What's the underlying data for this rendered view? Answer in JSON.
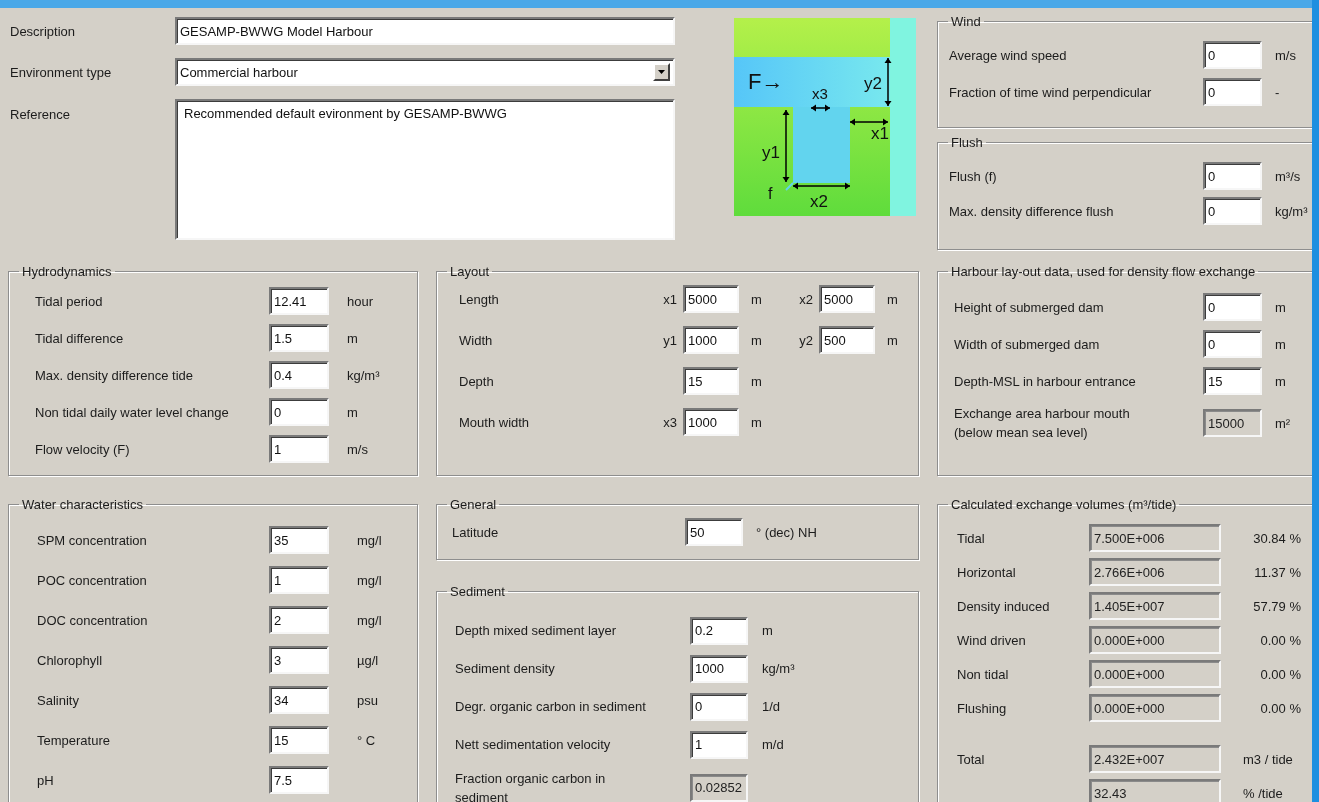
{
  "header": {
    "fields": [
      {
        "label": "Description",
        "value": "GESAMP-BWWG Model Harbour",
        "kind": "text"
      },
      {
        "label": "Environment type",
        "value": "Commercial harbour",
        "kind": "dropdown"
      },
      {
        "label": "Reference",
        "value": "Recommended default evironment by GESAMP-BWWG",
        "kind": "memo"
      }
    ]
  },
  "diagram": {
    "labels": [
      "F→",
      "x3",
      "y2",
      "y1",
      "x1",
      "f",
      "x2"
    ]
  },
  "wind": {
    "title": "Wind",
    "fields": [
      {
        "label": "Average wind speed",
        "value": "0",
        "unit": "m/s",
        "disabled": false
      },
      {
        "label": "Fraction of time wind perpendicular",
        "value": "0",
        "unit": "-",
        "disabled": false
      }
    ]
  },
  "flush": {
    "title": "Flush",
    "fields": [
      {
        "label": "Flush (f)",
        "value": "0",
        "unit": "m³/s",
        "disabled": false
      },
      {
        "label": "Max. density difference flush",
        "value": "0",
        "unit": "kg/m³",
        "disabled": false
      }
    ]
  },
  "hydrodynamics": {
    "title": "Hydrodynamics",
    "fields": [
      {
        "label": "Tidal period",
        "value": "12.41",
        "unit": "hour",
        "disabled": false
      },
      {
        "label": "Tidal difference",
        "value": "1.5",
        "unit": "m",
        "disabled": false
      },
      {
        "label": "Max. density difference tide",
        "value": "0.4",
        "unit": "kg/m³",
        "disabled": false
      },
      {
        "label": "Non tidal daily water level change",
        "value": "0",
        "unit": "m",
        "disabled": false
      },
      {
        "label": "Flow velocity (F)",
        "value": "1",
        "unit": "m/s",
        "disabled": false
      }
    ]
  },
  "layout": {
    "title": "Layout",
    "rows": [
      {
        "label": "Length",
        "fields": [
          {
            "symbol": "x1",
            "value": "5000",
            "unit": "m",
            "disabled": false
          },
          {
            "symbol": "x2",
            "value": "5000",
            "unit": "m",
            "disabled": false
          }
        ]
      },
      {
        "label": "Width",
        "fields": [
          {
            "symbol": "y1",
            "value": "1000",
            "unit": "m",
            "disabled": false
          },
          {
            "symbol": "y2",
            "value": "500",
            "unit": "m",
            "disabled": false
          }
        ]
      },
      {
        "label": "Depth",
        "fields": [
          {
            "value": "15",
            "unit": "m",
            "disabled": false
          }
        ]
      },
      {
        "label": "Mouth width",
        "fields": [
          {
            "symbol": "x3",
            "value": "1000",
            "unit": "m",
            "disabled": false
          }
        ]
      }
    ]
  },
  "harbour_layout": {
    "title": "Harbour lay-out data, used for density flow exchange",
    "fields": [
      {
        "label": "Height of submerged dam",
        "value": "0",
        "unit": "m",
        "disabled": false
      },
      {
        "label": "Width of submerged dam",
        "value": "0",
        "unit": "m",
        "disabled": false
      },
      {
        "label": "Depth-MSL in harbour entrance",
        "value": "15",
        "unit": "m",
        "disabled": false
      },
      {
        "label": "Exchange area harbour mouth\n(below mean sea level)",
        "value": "15000",
        "unit": "m²",
        "disabled": true
      }
    ]
  },
  "water_characteristics": {
    "title": "Water characteristics",
    "fields": [
      {
        "label": "SPM concentration",
        "value": "35",
        "unit": "mg/l",
        "disabled": false
      },
      {
        "label": "POC concentration",
        "value": "1",
        "unit": "mg/l",
        "disabled": false
      },
      {
        "label": "DOC concentration",
        "value": "2",
        "unit": "mg/l",
        "disabled": false
      },
      {
        "label": "Chlorophyll",
        "value": "3",
        "unit": "µg/l",
        "disabled": false
      },
      {
        "label": "Salinity",
        "value": "34",
        "unit": "psu",
        "disabled": false
      },
      {
        "label": "Temperature",
        "value": "15",
        "unit": "° C",
        "disabled": false
      },
      {
        "label": "pH",
        "value": "7.5",
        "disabled": false
      }
    ]
  },
  "general": {
    "title": "General",
    "fields": [
      {
        "label": "Latitude",
        "value": "50",
        "unit": "° (dec) NH",
        "disabled": false
      }
    ]
  },
  "sediment": {
    "title": "Sediment",
    "fields": [
      {
        "label": "Depth mixed sediment layer",
        "value": "0.2",
        "unit": "m",
        "disabled": false
      },
      {
        "label": "Sediment density",
        "value": "1000",
        "unit": "kg/m³",
        "disabled": false
      },
      {
        "label": "Degr. organic carbon in sediment",
        "value": "0",
        "unit": "1/d",
        "disabled": false
      },
      {
        "label": "Nett sedimentation velocity",
        "value": "1",
        "unit": "m/d",
        "disabled": false
      },
      {
        "label": "Fraction organic carbon in\nsediment",
        "value": "0.02852",
        "disabled": true
      }
    ]
  },
  "exchange_volumes": {
    "title": "Calculated exchange volumes (m³/tide)",
    "rows": [
      {
        "label": "Tidal",
        "value": "7.500E+006",
        "percent": "30.84 %",
        "disabled": true
      },
      {
        "label": "Horizontal",
        "value": "2.766E+006",
        "percent": "11.37 %",
        "disabled": true
      },
      {
        "label": "Density induced",
        "value": "1.405E+007",
        "percent": "57.79 %",
        "disabled": true
      },
      {
        "label": "Wind driven",
        "value": "0.000E+000",
        "percent": "0.00 %",
        "disabled": true
      },
      {
        "label": "Non tidal",
        "value": "0.000E+000",
        "percent": "0.00 %",
        "disabled": true
      },
      {
        "label": "Flushing",
        "value": "0.000E+000",
        "percent": "0.00 %",
        "disabled": true
      }
    ],
    "totals": [
      {
        "label": "Total",
        "value": "2.432E+007",
        "unit": "m3 / tide",
        "disabled": true
      },
      {
        "value": "32.43",
        "unit": "% /tide",
        "disabled": true
      }
    ]
  }
}
